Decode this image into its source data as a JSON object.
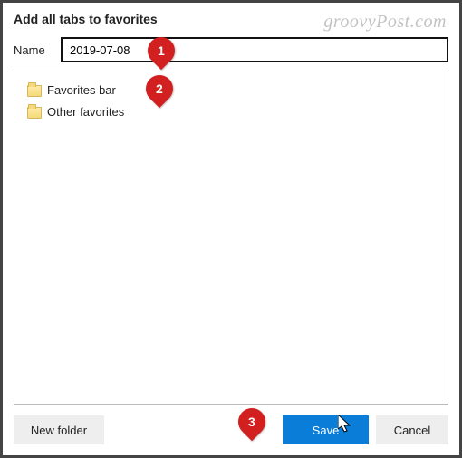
{
  "title": "Add all tabs to favorites",
  "nameRow": {
    "label": "Name",
    "value": "2019-07-08"
  },
  "tree": {
    "items": [
      {
        "label": "Favorites bar"
      },
      {
        "label": "Other favorites"
      }
    ]
  },
  "buttons": {
    "newFolder": "New folder",
    "save": "Save",
    "cancel": "Cancel"
  },
  "watermark": "groovyPost.com",
  "annotations": {
    "m1": "1",
    "m2": "2",
    "m3": "3"
  }
}
